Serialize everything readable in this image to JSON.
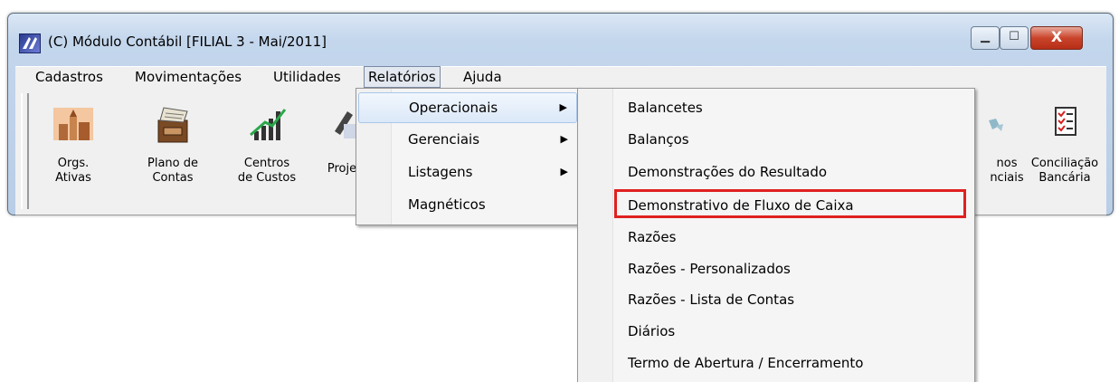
{
  "window": {
    "title": "(C) Módulo Contábil [FILIAL 3 - Mai/2011]",
    "controls": {
      "minimize": "▁",
      "maximize": "☐",
      "close": "X"
    }
  },
  "menubar": {
    "items": [
      "Cadastros",
      "Movimentações",
      "Utilidades",
      "Relatórios",
      "Ajuda"
    ]
  },
  "toolbar": {
    "buttons": [
      {
        "label_line1": "Orgs.",
        "label_line2": "Ativas",
        "icon": "buildings-icon"
      },
      {
        "label_line1": "Plano de",
        "label_line2": "Contas",
        "icon": "file-drawer-icon"
      },
      {
        "label_line1": "Centros",
        "label_line2": "de Custos",
        "icon": "chart-growth-icon"
      },
      {
        "label_line1": "Proje",
        "label_line2": "",
        "icon": "projects-icon"
      },
      {
        "label_line1": "nos",
        "label_line2": "nciais",
        "icon": "partial-icon"
      },
      {
        "label_line1": "Conciliação",
        "label_line2": "Bancária",
        "icon": "checklist-icon"
      }
    ]
  },
  "relatorios_menu": {
    "items": [
      {
        "label": "Operacionais",
        "arrow": "▶"
      },
      {
        "label": "Gerenciais",
        "arrow": "▶"
      },
      {
        "label": "Listagens",
        "arrow": "▶"
      },
      {
        "label": "Magnéticos",
        "arrow": ""
      }
    ]
  },
  "operacionais_menu": {
    "items": [
      "Balancetes",
      "Balanços",
      "Demonstrações do Resultado",
      "Demonstrativo de Fluxo de Caixa",
      "Razões",
      "Razões - Personalizados",
      "Razões - Lista de Contas",
      "Diários",
      "Termo de Abertura / Encerramento"
    ],
    "highlighted": "Demonstrativo de Fluxo de Caixa"
  },
  "colors": {
    "highlight_border": "#e02020",
    "menu_hover": "#dbe8f8"
  }
}
